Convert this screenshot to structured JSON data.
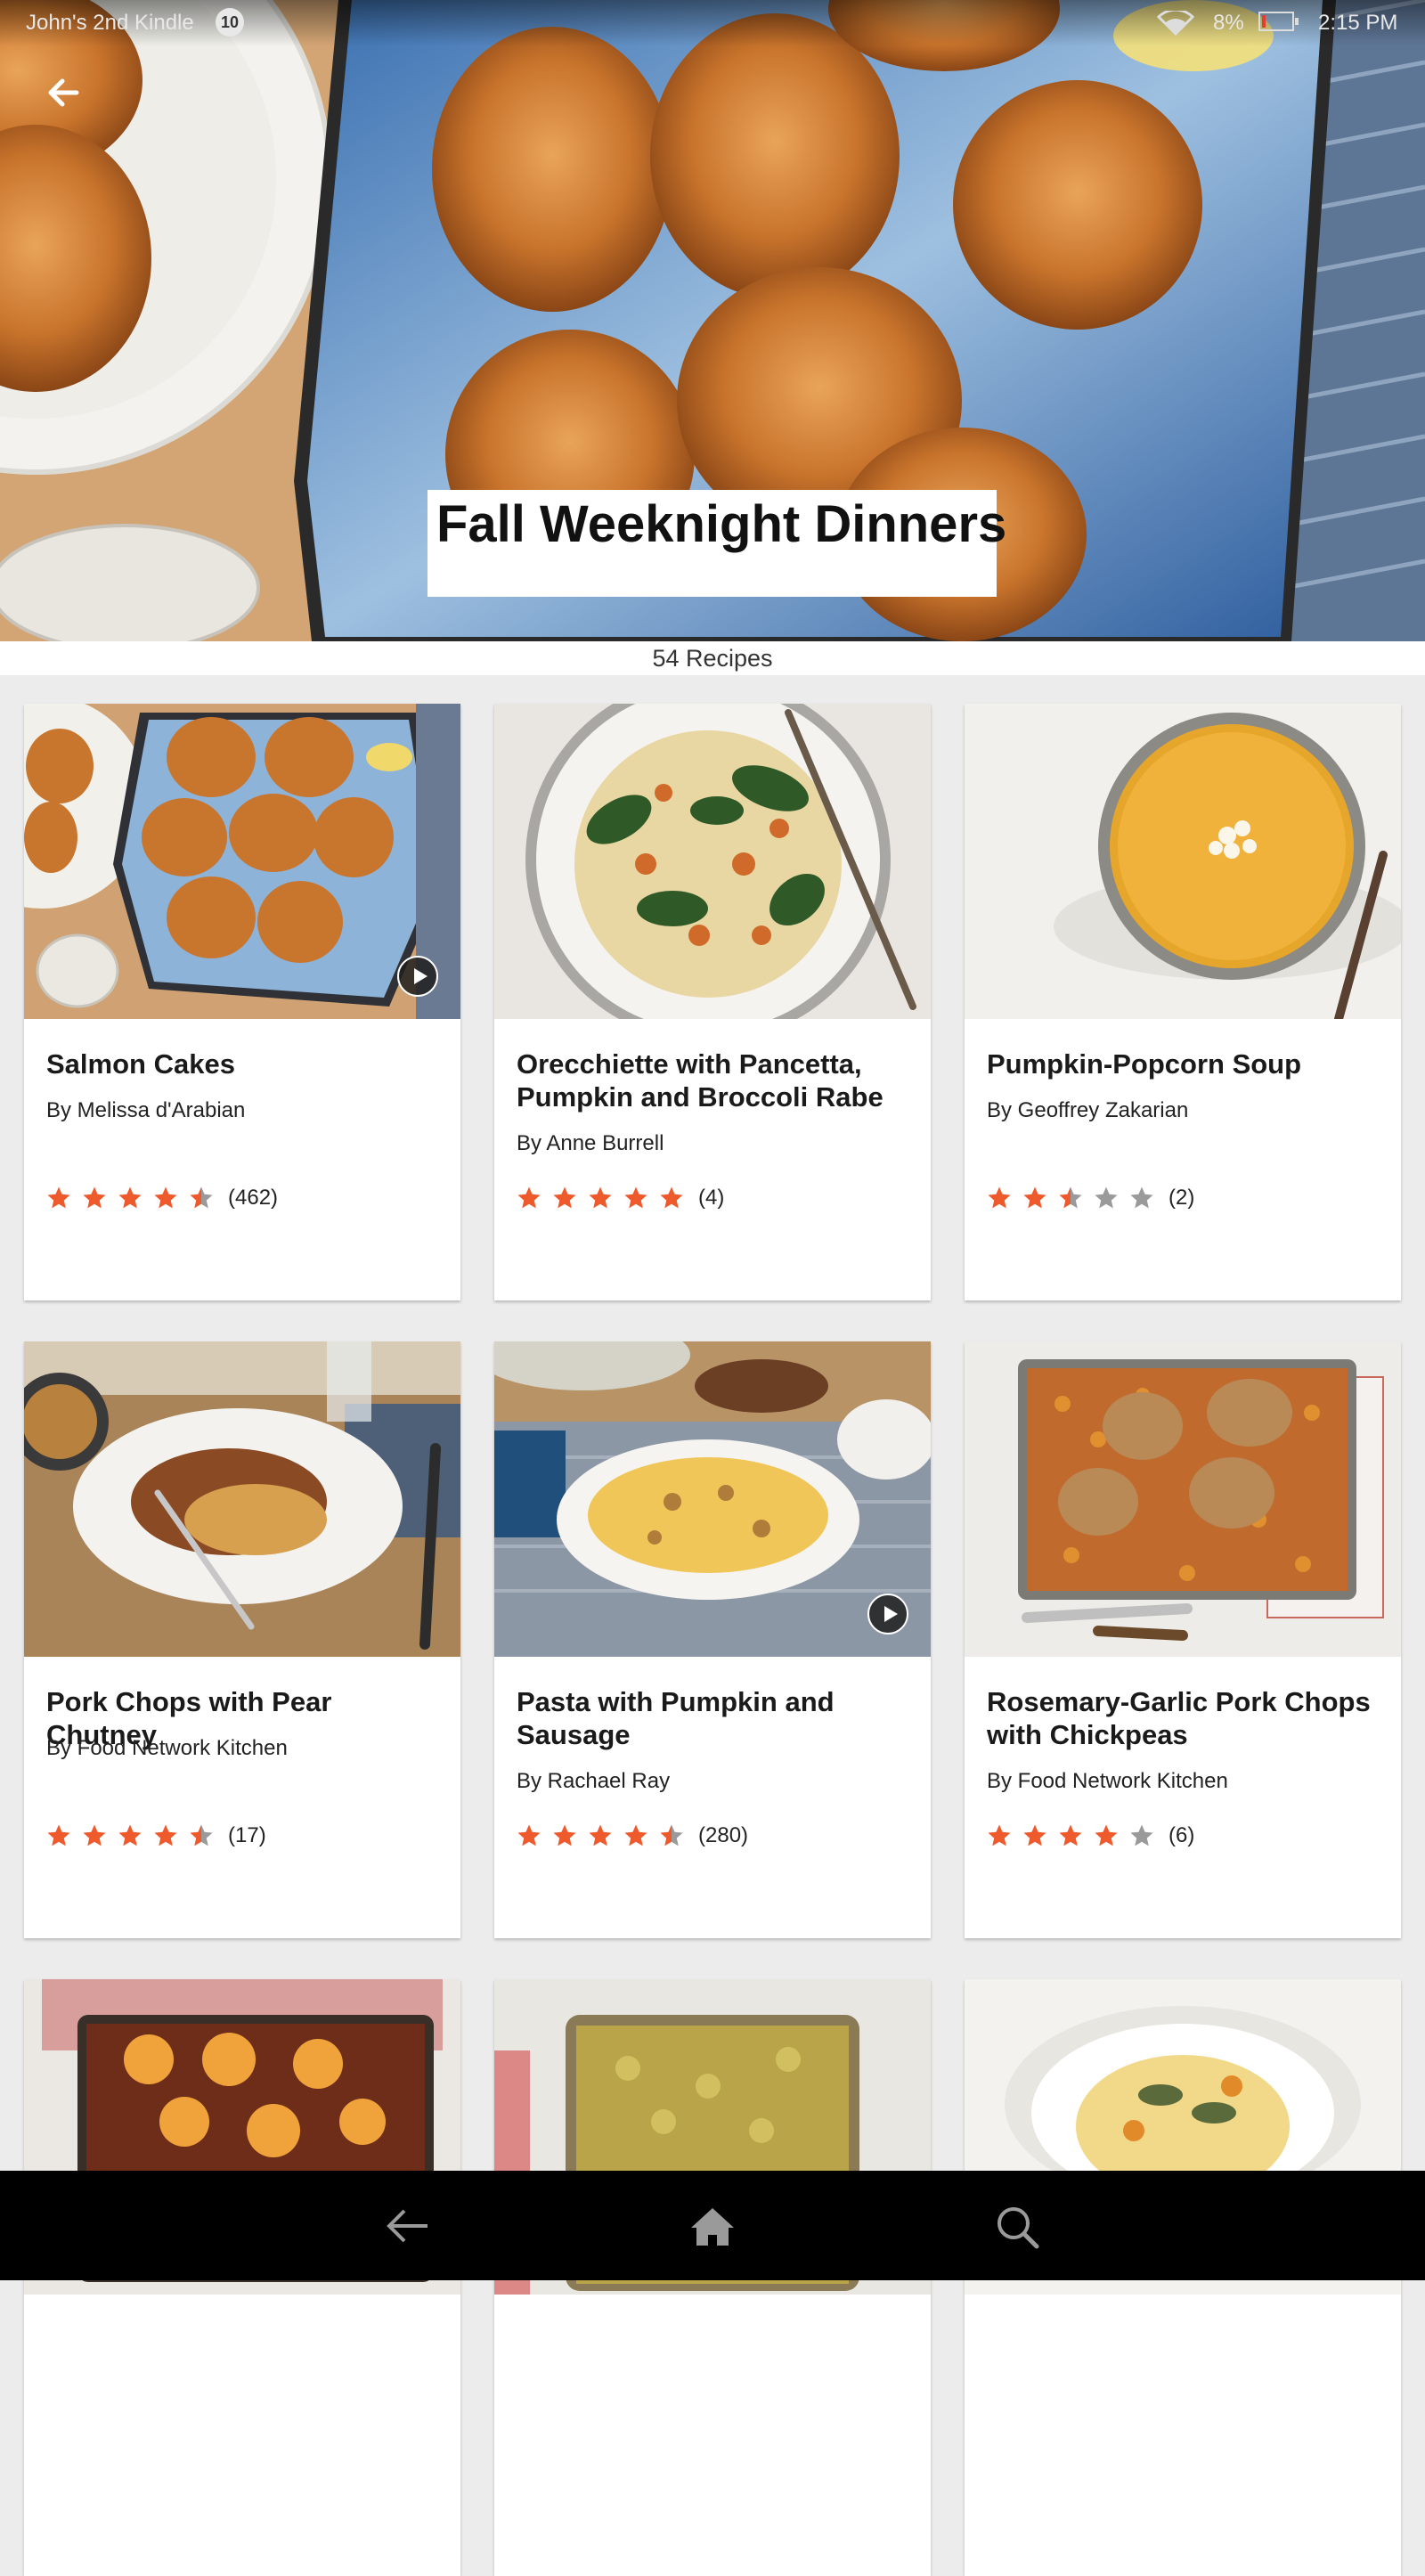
{
  "status_bar": {
    "device_name": "John's 2nd Kindle",
    "notification_count": "10",
    "battery_percent": "8%",
    "time": "2:15 PM",
    "icons": [
      "wifi-icon",
      "battery-icon"
    ]
  },
  "header": {
    "back_icon": "back-arrow-icon",
    "title": "Fall Weeknight Dinners",
    "recipe_count": "54 Recipes"
  },
  "colors": {
    "star_active": "#ee5a2c",
    "star_inactive": "#9a9a9a",
    "card_background": "#ffffff",
    "page_background": "#ececec",
    "nav_background": "#000000"
  },
  "recipes": [
    {
      "title": "Salmon Cakes",
      "author": "By Melissa d'Arabian",
      "rating": 4.5,
      "review_count": "(462)",
      "has_video": true
    },
    {
      "title": "Orecchiette with Pancetta, Pumpkin and Broccoli Rabe",
      "author": "By Anne Burrell",
      "rating": 5,
      "review_count": "(4)",
      "has_video": false
    },
    {
      "title": "Pumpkin-Popcorn Soup",
      "author": "By Geoffrey Zakarian",
      "rating": 2.5,
      "review_count": "(2)",
      "has_video": false
    },
    {
      "title": "Pork Chops with Pear Chutney",
      "author": "By Food Network Kitchen",
      "rating": 4.5,
      "review_count": "(17)",
      "has_video": false
    },
    {
      "title": "Pasta with Pumpkin and Sausage",
      "author": "By Rachael Ray",
      "rating": 4.5,
      "review_count": "(280)",
      "has_video": true
    },
    {
      "title": "Rosemary-Garlic Pork Chops with Chickpeas",
      "author": "By Food Network Kitchen",
      "rating": 4,
      "review_count": "(6)",
      "has_video": false
    }
  ],
  "nav_bar": {
    "icons": [
      "nav-back-icon",
      "home-icon",
      "search-icon"
    ]
  }
}
